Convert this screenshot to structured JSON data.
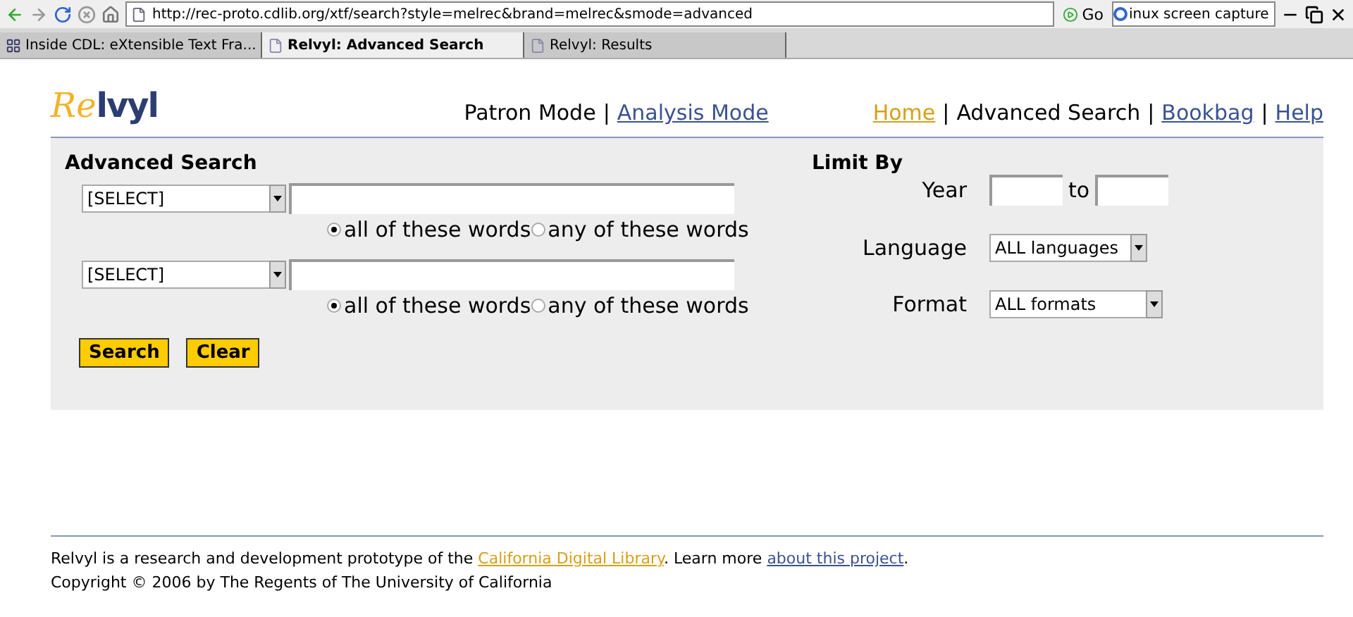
{
  "browser": {
    "url": "http://rec-proto.cdlib.org/xtf/search?style=melrec&brand=melrec&smode=advanced",
    "go_label": "Go",
    "search_value": "inux screen capture",
    "tabs": [
      {
        "label": "Inside CDL: eXtensible Text Fra...",
        "selected": false,
        "kind": "site"
      },
      {
        "label": "Relvyl: Advanced Search",
        "selected": true,
        "kind": "page"
      },
      {
        "label": "Relvyl: Results",
        "selected": false,
        "kind": "page"
      }
    ]
  },
  "logo": {
    "script": "Re",
    "bold": "lvyl"
  },
  "separator": "|",
  "modes": [
    {
      "label": "Patron Mode",
      "kind": "text"
    },
    {
      "label": "Analysis Mode",
      "kind": "link"
    }
  ],
  "nav": [
    {
      "label": "Home",
      "kind": "highlight"
    },
    {
      "label": "Advanced Search",
      "kind": "text"
    },
    {
      "label": "Bookbag",
      "kind": "link"
    },
    {
      "label": "Help",
      "kind": "link"
    }
  ],
  "search": {
    "title": "Advanced Search",
    "rows": [
      {
        "field": "[SELECT]",
        "options": [
          {
            "label": "all of these words",
            "selected": true
          },
          {
            "label": "any of these words",
            "selected": false
          }
        ]
      },
      {
        "field": "[SELECT]",
        "options": [
          {
            "label": "all of these words",
            "selected": true
          },
          {
            "label": "any of these words",
            "selected": false
          }
        ]
      }
    ],
    "buttons": [
      "Search",
      "Clear"
    ]
  },
  "limit": {
    "title": "Limit By",
    "year_label": "Year",
    "to_label": "to",
    "language_label": "Language",
    "language_value": "ALL languages",
    "format_label": "Format",
    "format_value": "ALL formats"
  },
  "footer": {
    "lines": [
      [
        {
          "text": "Relvyl is a research and development prototype of the ",
          "kind": "text"
        },
        {
          "text": "California Digital Library",
          "kind": "highlight"
        },
        {
          "text": ". Learn more ",
          "kind": "text"
        },
        {
          "text": "about this project",
          "kind": "link"
        },
        {
          "text": ".",
          "kind": "text"
        }
      ],
      [
        {
          "text": "Copyright © 2006 by The Regents of The University of California",
          "kind": "text"
        }
      ]
    ]
  }
}
